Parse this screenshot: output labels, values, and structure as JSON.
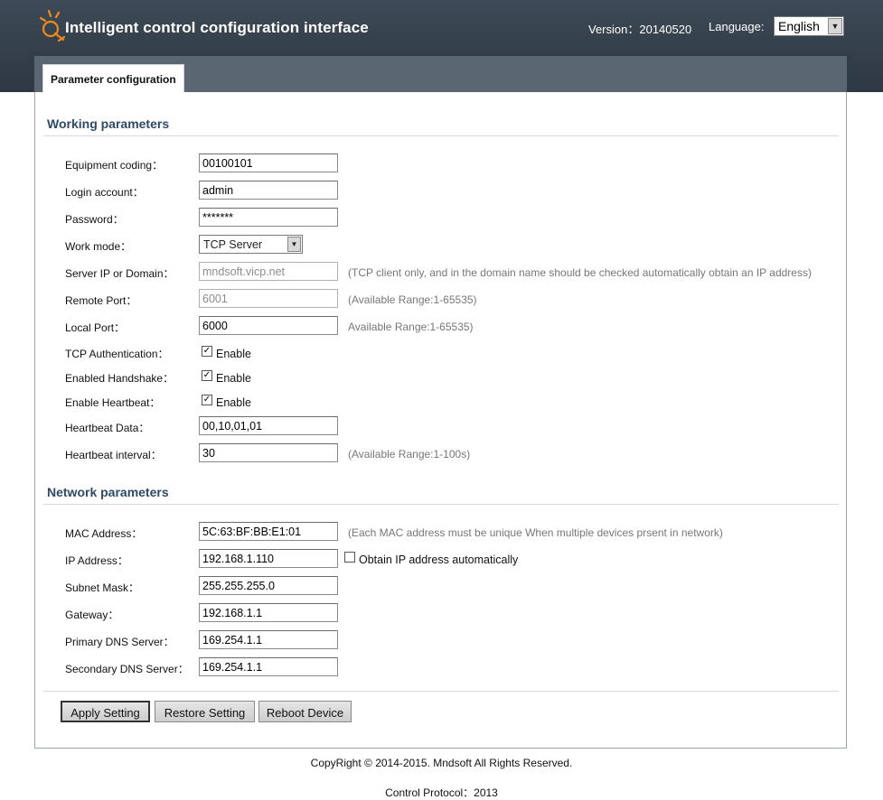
{
  "header": {
    "title": "Intelligent control configuration interface",
    "version": "Version：20140520",
    "language_label": "Language:",
    "language_value": "English",
    "accent_color": "#f08a1c",
    "logo_icon": "lightbulb-logo-icon"
  },
  "tabs": [
    {
      "label": "Parameter configuration",
      "active": true
    }
  ],
  "working": {
    "title": "Working parameters",
    "equipment_coding": {
      "label": "Equipment coding：",
      "value": "00100101"
    },
    "login_account": {
      "label": "Login account：",
      "value": "admin"
    },
    "password": {
      "label": "Password：",
      "value": "*******"
    },
    "work_mode": {
      "label": "Work mode：",
      "value": "TCP Server"
    },
    "server_ip": {
      "label": "Server IP or Domain：",
      "value": "mndsoft.vicp.net",
      "hint": "(TCP client only, and in the domain name should be checked automatically obtain an IP address)"
    },
    "remote_port": {
      "label": "Remote Port：",
      "value": "6001",
      "hint": "(Available Range:1-65535)"
    },
    "local_port": {
      "label": "Local Port：",
      "value": "6000",
      "hint": "Available Range:1-65535)"
    },
    "tcp_auth": {
      "label": "TCP Authentication：",
      "option": "Enable",
      "checked": true
    },
    "handshake": {
      "label": "Enabled Handshake：",
      "option": "Enable",
      "checked": true
    },
    "heartbeat": {
      "label": "Enable Heartbeat：",
      "option": "Enable",
      "checked": true
    },
    "heartbeat_data": {
      "label": "Heartbeat Data：",
      "value": "00,10,01,01"
    },
    "heartbeat_interval": {
      "label": "Heartbeat interval：",
      "value": "30",
      "hint": "(Available Range:1-100s)"
    }
  },
  "network": {
    "title": "Network parameters",
    "mac": {
      "label": "MAC Address：",
      "value": "5C:63:BF:BB:E1:01",
      "hint": "(Each MAC address must be unique When multiple devices prsent in network)"
    },
    "ip": {
      "label": "IP Address：",
      "value": "192.168.1.110",
      "auto_option": "Obtain IP address automatically",
      "auto_checked": false
    },
    "subnet": {
      "label": "Subnet Mask：",
      "value": "255.255.255.0"
    },
    "gateway": {
      "label": "Gateway：",
      "value": "192.168.1.1"
    },
    "dns1": {
      "label": "Primary DNS Server：",
      "value": "169.254.1.1"
    },
    "dns2": {
      "label": "Secondary DNS Server：",
      "value": "169.254.1.1"
    }
  },
  "buttons": {
    "apply": "Apply Setting",
    "restore": "Restore Setting",
    "reboot": "Reboot Device"
  },
  "footer": {
    "copyright": "CopyRight © 2014-2015. Mndsoft All Rights Reserved.",
    "protocol": "Control Protocol：2013"
  }
}
